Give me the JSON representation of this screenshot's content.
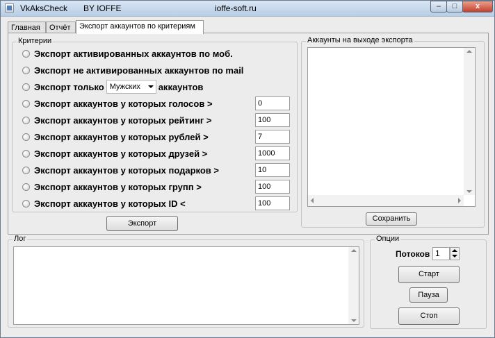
{
  "titlebar": {
    "app_name": "VkAksCheck",
    "author": "BY IOFFE",
    "site": "ioffe-soft.ru",
    "minimize_glyph": "–",
    "maximize_glyph": "□",
    "close_glyph": "x"
  },
  "tabs": [
    "Главная",
    "Отчёт",
    "Экспорт аккаунтов по критериям"
  ],
  "criteria": {
    "legend": "Критерии",
    "options": [
      {
        "label": "Экспорт активированных аккаунтов по моб."
      },
      {
        "label": "Экспорт не активированных аккаунтов по mail"
      },
      {
        "label_before": "Экспорт только",
        "combo_value": "Мужских",
        "label_after": "аккаунтов"
      },
      {
        "label": "Экспорт аккаунтов у которых голосов >",
        "value": "0"
      },
      {
        "label": "Экспорт аккаунтов у которых рейтинг >",
        "value": "100"
      },
      {
        "label": "Экспорт аккаунтов у которых рублей >",
        "value": "7"
      },
      {
        "label": "Экспорт аккаунтов у которых друзей >",
        "value": "1000"
      },
      {
        "label": "Экспорт аккаунтов у которых подарков >",
        "value": "10"
      },
      {
        "label": "Экспорт аккаунтов у которых групп >",
        "value": "100"
      },
      {
        "label": "Экспорт аккаунтов у которых  ID <",
        "value": "100"
      }
    ],
    "export_button": "Экспорт"
  },
  "output": {
    "legend": "Аккаунты на выходе экспорта",
    "save_button": "Сохранить"
  },
  "log": {
    "legend": "Лог"
  },
  "options": {
    "legend": "Опции",
    "threads_label": "Потоков",
    "threads_value": "1",
    "start_button": "Старт",
    "pause_button": "Пауза",
    "stop_button": "Стоп"
  }
}
